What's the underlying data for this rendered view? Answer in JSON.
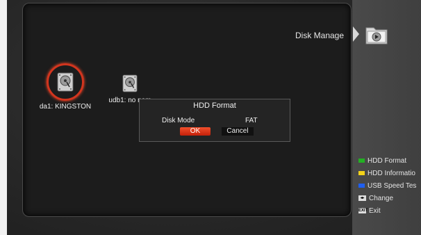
{
  "header": {
    "title": "Disk Manage"
  },
  "disks": [
    {
      "label": "da1: KINGSTON",
      "selected": true
    },
    {
      "label": "udb1: no nam",
      "selected": false
    }
  ],
  "dialog": {
    "title": "HDD Format",
    "mode_label": "Disk Mode",
    "mode_value": "FAT",
    "ok_label": "OK",
    "cancel_label": "Cancel"
  },
  "legend": [
    {
      "color": "#23b023",
      "label": "HDD Format"
    },
    {
      "color": "#f2d21a",
      "label": "HDD Informatio"
    },
    {
      "color": "#1f5ff0",
      "label": "USB Speed Tes"
    },
    {
      "key": "◂▸",
      "label": "Change"
    },
    {
      "key": "EXIT",
      "label": "Exit"
    }
  ],
  "colors": {
    "accent": "#d2351e",
    "ok_button": "#e2401f"
  }
}
